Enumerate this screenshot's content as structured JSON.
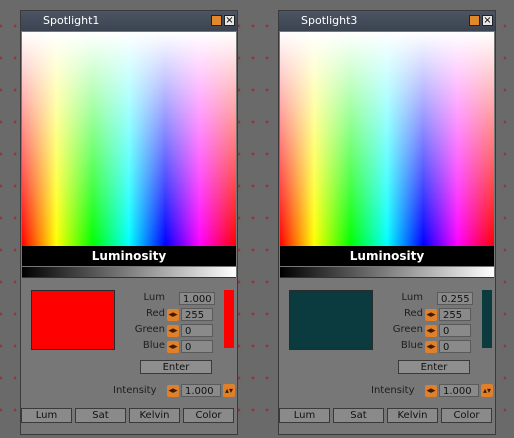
{
  "panels": [
    {
      "title": "Spotlight1",
      "luminosity_label": "Luminosity",
      "swatch_color": "#ff0000",
      "fields": [
        {
          "label": "Lum",
          "value": "1.000"
        },
        {
          "label": "Red",
          "value": "255"
        },
        {
          "label": "Green",
          "value": "0"
        },
        {
          "label": "Blue",
          "value": "0"
        }
      ],
      "enter_label": "Enter",
      "intensity_label": "Intensity",
      "intensity_value": "1.000",
      "tabs": [
        "Lum",
        "Sat",
        "Kelvin",
        "Color"
      ]
    },
    {
      "title": "Spotlight3",
      "luminosity_label": "Luminosity",
      "swatch_color": "#0b3b3f",
      "fields": [
        {
          "label": "Lum",
          "value": "0.255"
        },
        {
          "label": "Red",
          "value": "255"
        },
        {
          "label": "Green",
          "value": "0"
        },
        {
          "label": "Blue",
          "value": "0"
        }
      ],
      "enter_label": "Enter",
      "intensity_label": "Intensity",
      "intensity_value": "1.000",
      "tabs": [
        "Lum",
        "Sat",
        "Kelvin",
        "Color"
      ]
    }
  ],
  "icons": {
    "minimize": "orange-square-icon",
    "close": "close-icon",
    "arrows": "left-right-arrow-icon",
    "spinner": "up-down-spinner-icon"
  },
  "colors": {
    "titlebar": "#4b5563",
    "panel_bg": "#777777",
    "accent": "#e0802a"
  }
}
